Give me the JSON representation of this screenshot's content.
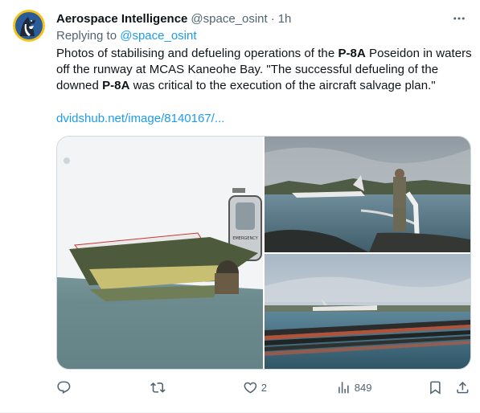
{
  "tweet": {
    "author_name": "Aerospace Intelligence",
    "handle": "@space_osint",
    "separator": "·",
    "time": "1h",
    "replying_prefix": "Replying to",
    "replying_to": "@space_osint",
    "text": {
      "p1": "Photos of stabilising and defueling operations of the",
      "b1": "P-8A",
      "p2": "Poseidon in waters off the runway at MCAS Kaneohe Bay. \"The successful defueling of the downed",
      "b2": "P-8A",
      "p3": "was critical to the execution of the aircraft salvage plan.\""
    },
    "link_text": "dvidshub.net/image/8140167/...",
    "images": [
      {
        "icon": "photo-defueling-wing-closeup"
      },
      {
        "icon": "photo-aircraft-in-water-with-hose"
      },
      {
        "icon": "photo-containment-boom"
      }
    ],
    "metrics": {
      "replies": "",
      "reposts": "",
      "likes": "2",
      "views": "849"
    },
    "icons": [
      "avatar-logo",
      "more-icon",
      "reply-icon",
      "repost-icon",
      "like-icon",
      "views-icon",
      "bookmark-icon",
      "share-icon"
    ]
  },
  "colors": {
    "text_primary": "#0f1419",
    "text_secondary": "#536471",
    "link": "#1d9bf0",
    "border": "#cfd9de"
  }
}
